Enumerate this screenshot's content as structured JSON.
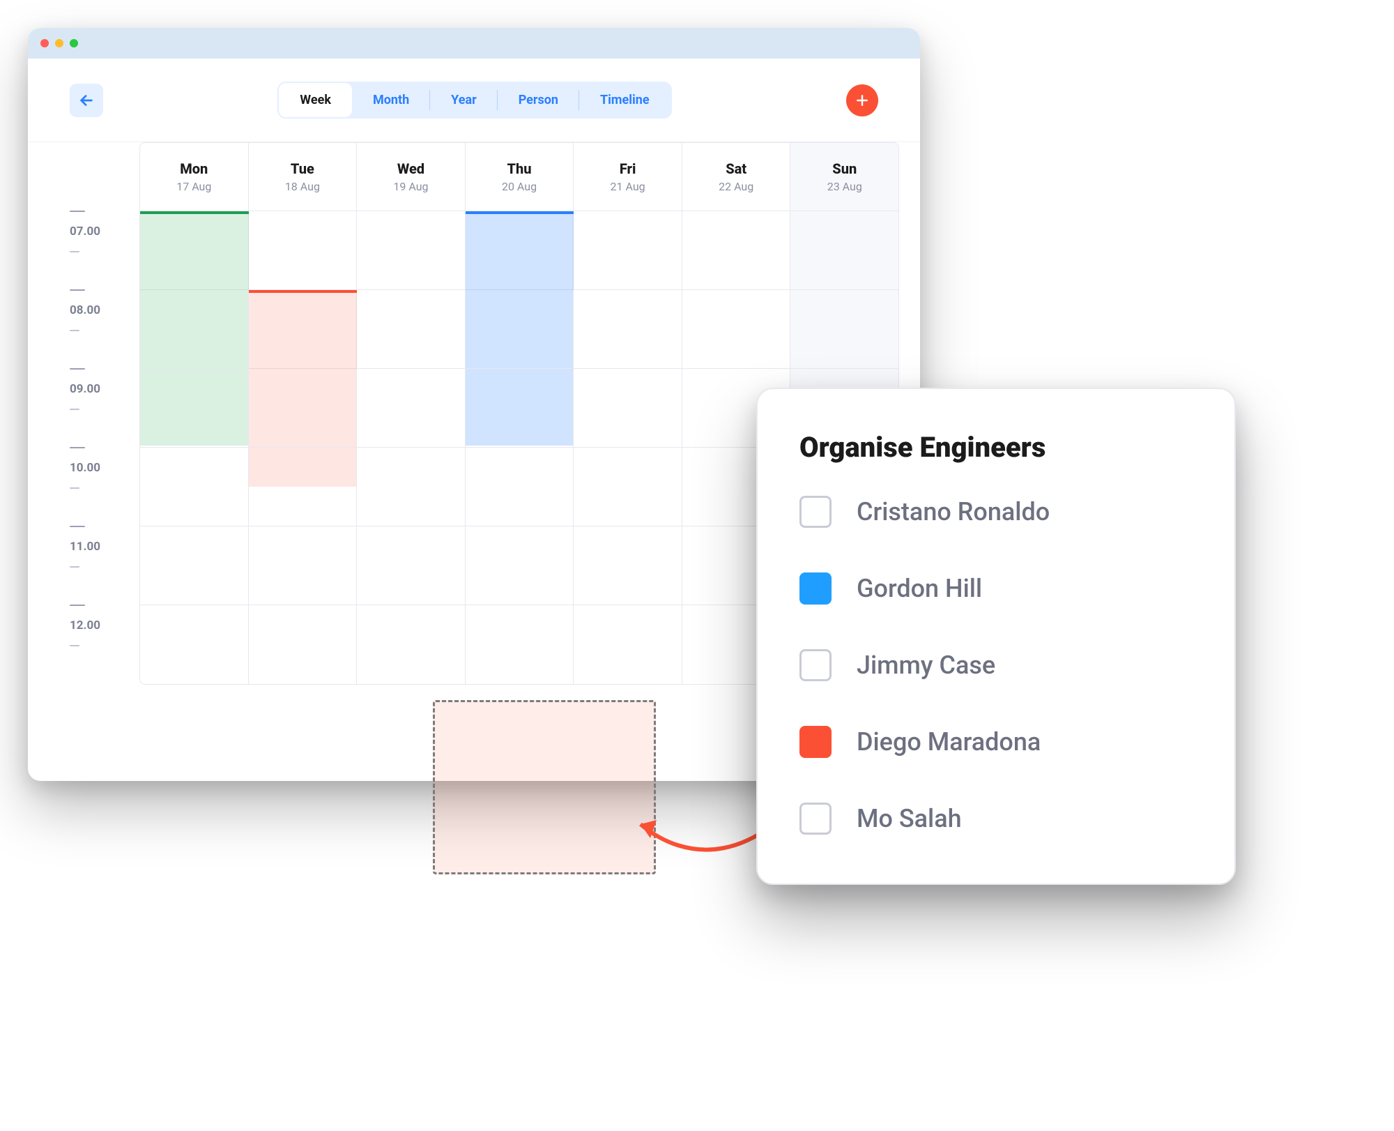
{
  "toolbar": {
    "views": [
      "Week",
      "Month",
      "Year",
      "Person",
      "Timeline"
    ],
    "active_view": "Week"
  },
  "calendar": {
    "days": [
      {
        "name": "Mon",
        "date": "17 Aug"
      },
      {
        "name": "Tue",
        "date": "18 Aug"
      },
      {
        "name": "Wed",
        "date": "19 Aug"
      },
      {
        "name": "Thu",
        "date": "20 Aug"
      },
      {
        "name": "Fri",
        "date": "21 Aug"
      },
      {
        "name": "Sat",
        "date": "22 Aug"
      },
      {
        "name": "Sun",
        "date": "23 Aug"
      }
    ],
    "times": [
      "07.00",
      "08.00",
      "09.00",
      "10.00",
      "11.00",
      "12.00"
    ],
    "events": [
      {
        "day": 0,
        "start": "07.00",
        "end": "10.00",
        "color": "green"
      },
      {
        "day": 1,
        "start": "08.00",
        "end": "10.30",
        "color": "red"
      },
      {
        "day": 3,
        "start": "07.00",
        "end": "10.00",
        "color": "blue"
      }
    ]
  },
  "panel": {
    "title": "Organise Engineers",
    "engineers": [
      {
        "name": "Cristano Ronaldo",
        "color": null
      },
      {
        "name": "Gordon Hill",
        "color": "blue"
      },
      {
        "name": "Jimmy Case",
        "color": null
      },
      {
        "name": "Diego Maradona",
        "color": "red"
      },
      {
        "name": "Mo Salah",
        "color": null
      }
    ]
  }
}
